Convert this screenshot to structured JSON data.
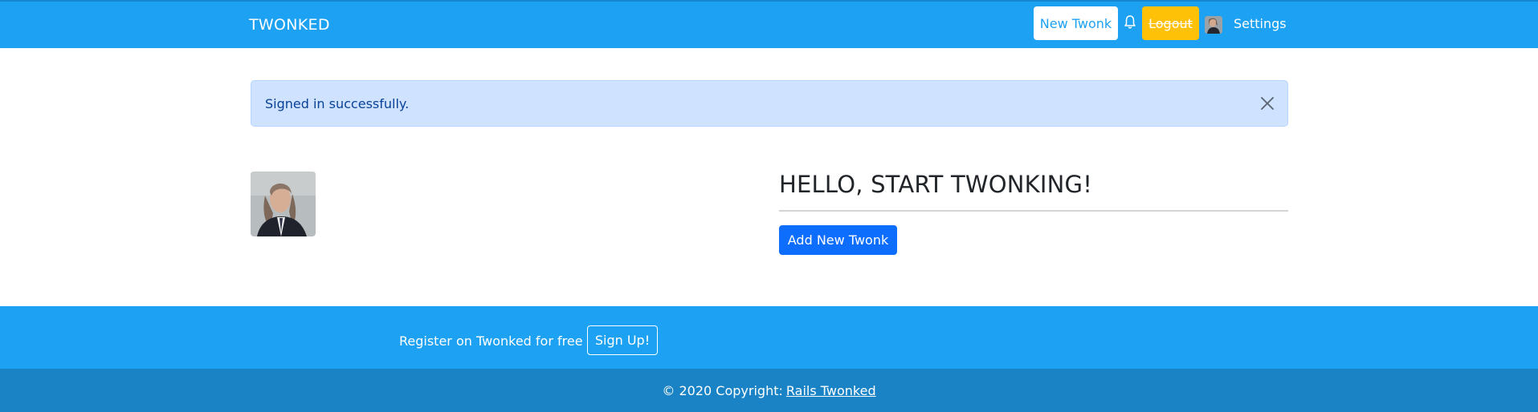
{
  "navbar": {
    "brand": "TWONKED",
    "new_twonk_label": "New Twonk",
    "logout_label": "Logout",
    "settings_label": "Settings",
    "bell_icon": "bell-icon",
    "colors": {
      "background": "#1da1f2",
      "logout": "#ffc107"
    }
  },
  "alert": {
    "message": "Signed in successfully.",
    "close_icon": "close-icon"
  },
  "main": {
    "heading": "HELLO, START TWONKING!",
    "add_button_label": "Add New Twonk"
  },
  "footer": {
    "register_text": "Register on Twonked for free",
    "signup_label": "Sign Up!",
    "copyright": "© 2020 Copyright:",
    "link_text": "Rails Twonked"
  }
}
